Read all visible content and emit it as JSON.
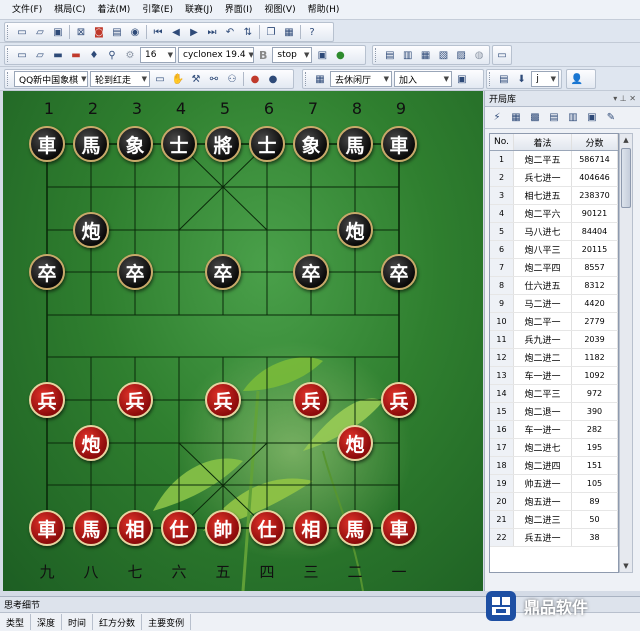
{
  "menu": [
    "文件(F)",
    "棋局(C)",
    "着法(M)",
    "引擎(E)",
    "联赛(J)",
    "界面(I)",
    "视图(V)",
    "帮助(H)"
  ],
  "toolbar": {
    "depth_value": "16",
    "engine_name": "cyclonex 19.4",
    "bold_label": "B",
    "stop_value": "stop",
    "book_name": "QQ新中国象棋",
    "turn_value": "轮到红走",
    "hall_value": "去休闲厅",
    "join_value": "加入",
    "j_value": "j"
  },
  "board": {
    "top_files": [
      "1",
      "2",
      "3",
      "4",
      "5",
      "6",
      "7",
      "8",
      "9"
    ],
    "bottom_files": [
      "九",
      "八",
      "七",
      "六",
      "五",
      "四",
      "三",
      "二",
      "一"
    ],
    "black_back": [
      "車",
      "馬",
      "象",
      "士",
      "將",
      "士",
      "象",
      "馬",
      "車"
    ],
    "black_cannon": "炮",
    "black_pawn": "卒",
    "red_back": [
      "車",
      "馬",
      "相",
      "仕",
      "帥",
      "仕",
      "相",
      "馬",
      "車"
    ],
    "red_cannon": "炮",
    "red_pawn": "兵"
  },
  "opening_book": {
    "title": "开局库",
    "headers": [
      "No.",
      "着法",
      "分数"
    ],
    "rows": [
      [
        "1",
        "炮二平五",
        "586714"
      ],
      [
        "2",
        "兵七进一",
        "404646"
      ],
      [
        "3",
        "相七进五",
        "238370"
      ],
      [
        "4",
        "炮二平六",
        "90121"
      ],
      [
        "5",
        "马八进七",
        "84404"
      ],
      [
        "6",
        "炮八平三",
        "20115"
      ],
      [
        "7",
        "炮二平四",
        "8557"
      ],
      [
        "8",
        "仕六进五",
        "8312"
      ],
      [
        "9",
        "马二进一",
        "4420"
      ],
      [
        "10",
        "炮二平一",
        "2779"
      ],
      [
        "11",
        "兵九进一",
        "2039"
      ],
      [
        "12",
        "炮二进二",
        "1182"
      ],
      [
        "13",
        "车一进一",
        "1092"
      ],
      [
        "14",
        "炮二平三",
        "972"
      ],
      [
        "15",
        "炮二退一",
        "390"
      ],
      [
        "16",
        "车一进一",
        "282"
      ],
      [
        "17",
        "炮二进七",
        "195"
      ],
      [
        "18",
        "炮二进四",
        "151"
      ],
      [
        "19",
        "帅五进一",
        "105"
      ],
      [
        "20",
        "炮五进一",
        "89"
      ],
      [
        "21",
        "炮二进三",
        "50"
      ],
      [
        "22",
        "兵五进一",
        "38"
      ]
    ]
  },
  "think_panel": {
    "title": "思考细节",
    "columns": [
      "类型",
      "深度",
      "时间",
      "红方分数",
      "主要变例"
    ]
  },
  "watermark": {
    "text": "鼎品软件"
  }
}
